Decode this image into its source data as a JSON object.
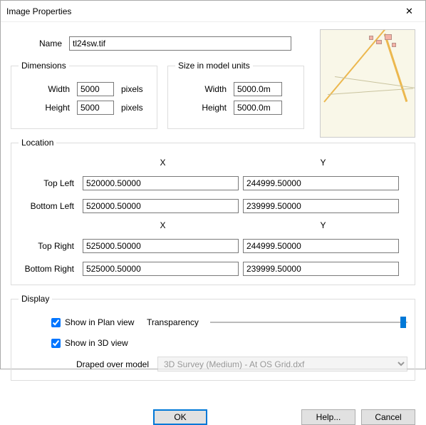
{
  "window": {
    "title": "Image Properties",
    "close": "✕"
  },
  "name": {
    "label": "Name",
    "value": "tl24sw.tif"
  },
  "dimensions": {
    "legend": "Dimensions",
    "width_label": "Width",
    "width": "5000",
    "width_unit": "pixels",
    "height_label": "Height",
    "height": "5000",
    "height_unit": "pixels"
  },
  "modelunits": {
    "legend": "Size in model units",
    "width_label": "Width",
    "width": "5000.0m",
    "height_label": "Height",
    "height": "5000.0m"
  },
  "location": {
    "legend": "Location",
    "x_label": "X",
    "y_label": "Y",
    "top_left_label": "Top Left",
    "top_left_x": "520000.50000",
    "top_left_y": "244999.50000",
    "bottom_left_label": "Bottom Left",
    "bottom_left_x": "520000.50000",
    "bottom_left_y": "239999.50000",
    "top_right_label": "Top Right",
    "top_right_x": "525000.50000",
    "top_right_y": "244999.50000",
    "bottom_right_label": "Bottom Right",
    "bottom_right_x": "525000.50000",
    "bottom_right_y": "239999.50000"
  },
  "display": {
    "legend": "Display",
    "plan_label": "Show in Plan view",
    "threed_label": "Show in 3D view",
    "transparency_label": "Transparency",
    "drape_label": "Draped over model",
    "drape_value": "3D Survey (Medium) - At OS Grid.dxf"
  },
  "buttons": {
    "ok": "OK",
    "help": "Help...",
    "cancel": "Cancel"
  }
}
